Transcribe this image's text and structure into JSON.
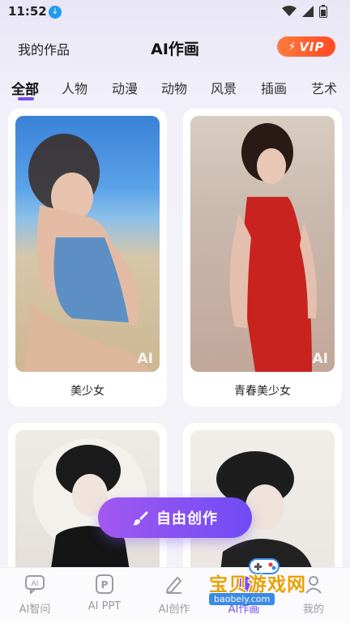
{
  "status_bar": {
    "time": "11:52"
  },
  "header": {
    "my_works": "我的作品",
    "title": "AI作画",
    "vip_label": "VIP"
  },
  "tabs": [
    "全部",
    "人物",
    "动漫",
    "动物",
    "风景",
    "插画",
    "艺术"
  ],
  "cards": [
    {
      "caption": "美少女",
      "badge": "AI"
    },
    {
      "caption": "青春美少女",
      "badge": "AI"
    },
    {
      "caption": "",
      "badge": ""
    },
    {
      "caption": "",
      "badge": ""
    }
  ],
  "create_button": {
    "label": "自由创作"
  },
  "bottom_nav": [
    {
      "label": "AI智问",
      "icon": "ai-chat-icon"
    },
    {
      "label": "AI PPT",
      "icon": "ppt-icon"
    },
    {
      "label": "AI创作",
      "icon": "pen-icon"
    },
    {
      "label": "AI作画",
      "icon": "paint-icon"
    },
    {
      "label": "我的",
      "icon": "profile-icon"
    }
  ],
  "watermark": {
    "text": "宝贝游戏网",
    "url": "baobeiy.com"
  },
  "colors": {
    "accent": "#7b4cf4",
    "vip": "#ff5a2a",
    "watermark": "#e9a10a"
  }
}
